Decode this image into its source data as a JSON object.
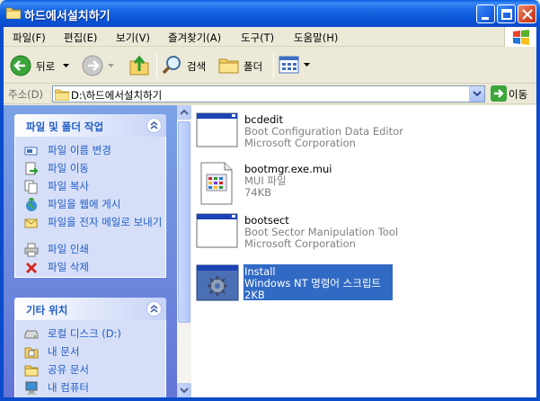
{
  "window": {
    "title": "하드에서설치하기"
  },
  "menu": [
    "파일(F)",
    "편집(E)",
    "보기(V)",
    "즐겨찾기(A)",
    "도구(T)",
    "도움말(H)"
  ],
  "toolbar": {
    "back_label": "뒤로",
    "search_label": "검색",
    "folders_label": "폴더"
  },
  "address": {
    "label": "주소(D)",
    "value": "D:\\하드에서설치하기",
    "go_label": "이동"
  },
  "tasks_panel": {
    "title": "파일 및 폴더 작업",
    "items": [
      {
        "label": "파일 이름 변경",
        "icon": "rename-icon"
      },
      {
        "label": "파일 이동",
        "icon": "move-icon"
      },
      {
        "label": "파일 복사",
        "icon": "copy-icon"
      },
      {
        "label": "파일을 웹에 게시",
        "icon": "web-publish-icon"
      },
      {
        "label": "파일을 전자 메일로 보내기",
        "icon": "email-icon"
      },
      {
        "label": "파일 인쇄",
        "icon": "printer-icon"
      },
      {
        "label": "파일 삭제",
        "icon": "delete-icon"
      }
    ]
  },
  "places_panel": {
    "title": "기타 위치",
    "items": [
      {
        "label": "로컬 디스크 (D:)",
        "icon": "drive-icon"
      },
      {
        "label": "내 문서",
        "icon": "my-documents-icon"
      },
      {
        "label": "공유 문서",
        "icon": "shared-folder-icon"
      },
      {
        "label": "내 컴퓨터",
        "icon": "my-computer-icon"
      }
    ]
  },
  "files": [
    {
      "name": "bcdedit",
      "line1": "Boot Configuration Data Editor",
      "line2": "Microsoft Corporation",
      "icon": "application-icon",
      "selected": false
    },
    {
      "name": "bootmgr.exe.mui",
      "line1": "MUI 파일",
      "line2": "74KB",
      "icon": "mui-file-icon",
      "selected": false
    },
    {
      "name": "bootsect",
      "line1": "Boot Sector Manipulation Tool",
      "line2": "Microsoft Corporation",
      "icon": "application-icon",
      "selected": false
    },
    {
      "name": "Install",
      "line1": "Windows NT 명령어 스크립트",
      "line2": "2KB",
      "icon": "script-gear-icon",
      "selected": true
    }
  ],
  "colors": {
    "titlebar": "#0a5be0",
    "task_link": "#215dc6",
    "selection": "#316ac5"
  }
}
